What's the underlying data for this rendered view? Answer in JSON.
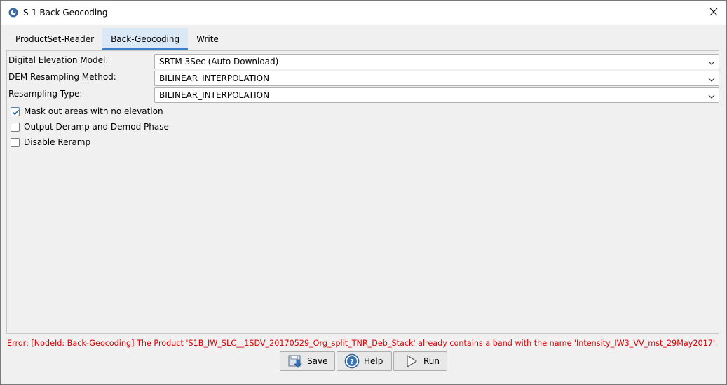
{
  "window": {
    "title": "S-1 Back Geocoding"
  },
  "tabs": [
    {
      "label": "ProductSet-Reader",
      "active": false
    },
    {
      "label": "Back-Geocoding",
      "active": true
    },
    {
      "label": "Write",
      "active": false
    }
  ],
  "form": {
    "dem": {
      "label": "Digital Elevation Model:",
      "value": "SRTM 3Sec (Auto Download)"
    },
    "dem_resampling": {
      "label": "DEM Resampling Method:",
      "value": "BILINEAR_INTERPOLATION"
    },
    "resampling_type": {
      "label": "Resampling Type:",
      "value": "BILINEAR_INTERPOLATION"
    },
    "checkboxes": [
      {
        "label": "Mask out areas with no elevation",
        "checked": true
      },
      {
        "label": "Output Deramp and Demod Phase",
        "checked": false
      },
      {
        "label": "Disable Reramp",
        "checked": false
      }
    ]
  },
  "status": {
    "error": "Error: [NodeId: Back-Geocoding] The Product 'S1B_IW_SLC__1SDV_20170529_Org_split_TNR_Deb_Stack' already contains a band with the name 'Intensity_IW3_VV_mst_29May2017'."
  },
  "buttons": {
    "save": "Save",
    "help": "Help",
    "run": "Run"
  },
  "colors": {
    "error": "#e00000",
    "tab_active_bg": "#dbe8f5",
    "tab_active_underline": "#3c7fc8"
  }
}
